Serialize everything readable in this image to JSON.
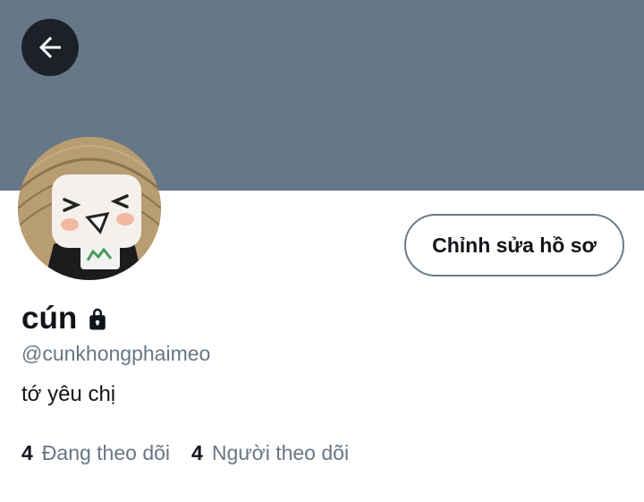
{
  "header": {
    "back_button_icon": "arrow-left-icon",
    "banner_color": "#667788"
  },
  "profile": {
    "avatar_icon": "avatar-image",
    "edit_button_label": "Chỉnh sửa hồ sơ",
    "display_name": "cún",
    "lock_icon": "lock-icon",
    "handle": "@cunkhongphaimeo",
    "bio": "tớ yêu chị"
  },
  "stats": {
    "following": {
      "count": "4",
      "label": "Đang theo dõi"
    },
    "followers": {
      "count": "4",
      "label": "Người theo dõi"
    }
  },
  "colors": {
    "text_primary": "#111418",
    "text_secondary": "#687684",
    "button_border": "#6b7b8a",
    "back_button_bg": "#1b2127"
  }
}
